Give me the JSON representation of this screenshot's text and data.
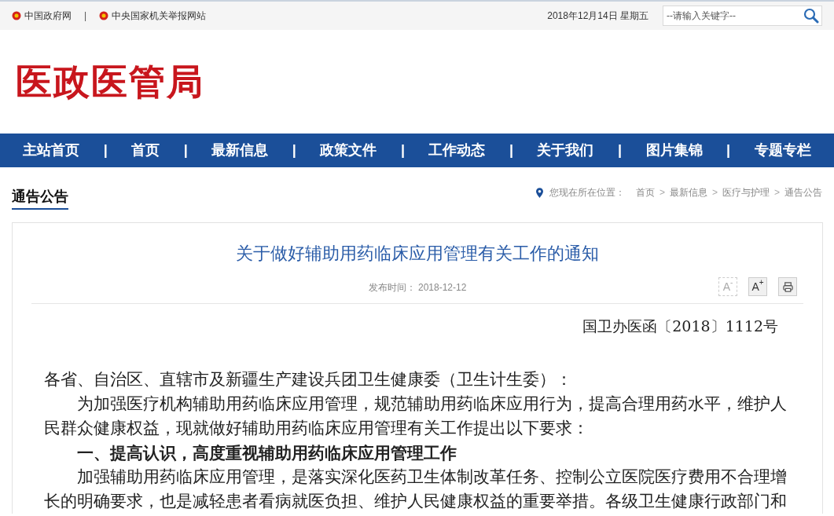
{
  "top_bar": {
    "links": [
      {
        "label": "中国政府网"
      },
      {
        "label": "中央国家机关举报网站"
      }
    ],
    "separator": "|",
    "date": "2018年12月14日 星期五",
    "search": {
      "placeholder": "--请输入关键字--"
    }
  },
  "header": {
    "logo_text": "医政医管局"
  },
  "nav": {
    "separator": "|",
    "items": [
      {
        "label": "主站首页"
      },
      {
        "label": "首页"
      },
      {
        "label": "最新信息"
      },
      {
        "label": "政策文件"
      },
      {
        "label": "工作动态"
      },
      {
        "label": "关于我们"
      },
      {
        "label": "图片集锦"
      },
      {
        "label": "专题专栏"
      }
    ]
  },
  "section": {
    "title": "通告公告",
    "breadcrumb": {
      "prefix": "您现在所在位置：",
      "items": [
        "首页",
        "最新信息",
        "医疗与护理",
        "通告公告"
      ],
      "separator": ">"
    }
  },
  "article": {
    "title": "关于做好辅助用药临床应用管理有关工作的通知",
    "publish": "发布时间： 2018-12-12",
    "tools": [
      {
        "kind": "smaller",
        "label": "A",
        "sup": "-",
        "disabled": true
      },
      {
        "kind": "larger",
        "label": "A",
        "sup": "+",
        "disabled": false
      },
      {
        "kind": "print",
        "disabled": false
      }
    ],
    "doc_number": "国卫办医函〔2018〕1112号",
    "paragraphs": [
      {
        "kind": "salutation",
        "text": "各省、自治区、直辖市及新疆生产建设兵团卫生健康委（卫生计生委）："
      },
      {
        "kind": "body",
        "text": "为加强医疗机构辅助用药临床应用管理，规范辅助用药临床应用行为，提高合理用药水平，维护人民群众健康权益，现就做好辅助用药临床应用管理有关工作提出以下要求："
      },
      {
        "kind": "heading",
        "text": "一、提高认识，高度重视辅助用药临床应用管理工作"
      },
      {
        "kind": "body",
        "text": "加强辅助用药临床应用管理，是落实深化医药卫生体制改革任务、控制公立医院医疗费用不合理增长的明确要求，也是减轻患者看病就医负担、维护人民健康权益的重要举措。各级卫生健康行政部门和"
      }
    ]
  }
}
